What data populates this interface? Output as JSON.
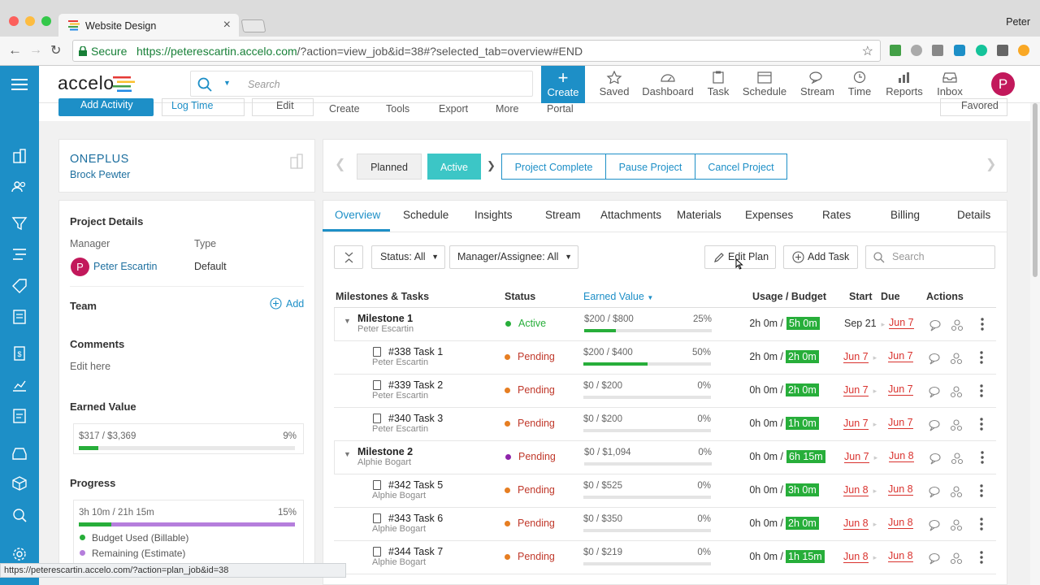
{
  "browser": {
    "tab_title": "Website Design",
    "user": "Peter",
    "secure_label": "Secure",
    "url_host": "https://peterescartin.accelo.com",
    "url_rest": "/?action=view_job&id=38#?selected_tab=overview#END",
    "status_url": "https://peterescartin.accelo.com/?action=plan_job&id=38"
  },
  "header": {
    "logo": "accelo",
    "search_placeholder": "Search",
    "create_label": "Create",
    "nav": [
      "Saved",
      "Dashboard",
      "Task",
      "Schedule",
      "Stream",
      "Time",
      "Reports",
      "Inbox"
    ],
    "avatar_initial": "P"
  },
  "toolbar": {
    "add_activity": "Add Activity",
    "log_time": "Log Time",
    "edit": "Edit",
    "create": "Create",
    "tools": "Tools",
    "export": "Export",
    "more": "More",
    "portal": "Portal",
    "favored": "Favored"
  },
  "project": {
    "company": "ONEPLUS",
    "contact": "Brock Pewter"
  },
  "details": {
    "heading": "Project Details",
    "manager_label": "Manager",
    "type_label": "Type",
    "manager_initial": "P",
    "manager_name": "Peter Escartin",
    "type_value": "Default",
    "team_heading": "Team",
    "team_add": "Add",
    "comments_heading": "Comments",
    "comments_value": "Edit here",
    "earned_heading": "Earned Value",
    "earned_amount": "$317 / $3,369",
    "earned_pct": "9%",
    "earned_fraction": 0.09,
    "progress_heading": "Progress",
    "progress_amount": "3h 10m / 21h 15m",
    "progress_pct": "15%",
    "progress_fraction": 0.15,
    "legend_billable": "Budget Used (Billable)",
    "legend_remaining": "Remaining (Estimate)",
    "color_billable": "#27ae3a",
    "color_remaining": "#b57edc"
  },
  "status": {
    "planned": "Planned",
    "active": "Active",
    "complete": "Project Complete",
    "pause": "Pause Project",
    "cancel": "Cancel Project"
  },
  "tabs": [
    "Overview",
    "Schedule",
    "Insights",
    "Stream",
    "Attachments",
    "Materials",
    "Expenses",
    "Rates",
    "Billing",
    "Details"
  ],
  "filters": {
    "status": "Status: All",
    "manager": "Manager/Assignee: All",
    "edit_plan": "Edit Plan",
    "add_task": "Add Task",
    "search_placeholder": "Search"
  },
  "table": {
    "headers": {
      "name": "Milestones & Tasks",
      "status": "Status",
      "earned": "Earned Value",
      "usage": "Usage / Budget",
      "start": "Start",
      "due": "Due",
      "actions": "Actions"
    },
    "rows": [
      {
        "kind": "milestone",
        "name": "Milestone 1",
        "assignee": "Peter Escartin",
        "status": "Active",
        "status_color": "#27ae3a",
        "earned": "$200 / $800",
        "earned_pct": "25%",
        "earned_fraction": 0.25,
        "used": "2h 0m /",
        "budget": "5h 0m",
        "start": "Sep 21",
        "start_red": false,
        "due": "Jun 7"
      },
      {
        "kind": "task",
        "name": "#338 Task 1",
        "assignee": "Peter Escartin",
        "status": "Pending",
        "status_color": "#e67e22",
        "earned": "$200 / $400",
        "earned_pct": "50%",
        "earned_fraction": 0.5,
        "used": "2h 0m /",
        "budget": "2h 0m",
        "start": "Jun 7",
        "start_red": true,
        "due": "Jun 7"
      },
      {
        "kind": "task",
        "name": "#339 Task 2",
        "assignee": "Peter Escartin",
        "status": "Pending",
        "status_color": "#e67e22",
        "earned": "$0 / $200",
        "earned_pct": "0%",
        "earned_fraction": 0,
        "used": "0h 0m /",
        "budget": "2h 0m",
        "start": "Jun 7",
        "start_red": true,
        "due": "Jun 7"
      },
      {
        "kind": "task",
        "name": "#340 Task 3",
        "assignee": "Peter Escartin",
        "status": "Pending",
        "status_color": "#e67e22",
        "earned": "$0 / $200",
        "earned_pct": "0%",
        "earned_fraction": 0,
        "used": "0h 0m /",
        "budget": "1h 0m",
        "start": "Jun 7",
        "start_red": true,
        "due": "Jun 7"
      },
      {
        "kind": "milestone",
        "name": "Milestone 2",
        "assignee": "Alphie Bogart",
        "status": "Pending",
        "status_color": "#8e24aa",
        "earned": "$0 / $1,094",
        "earned_pct": "0%",
        "earned_fraction": 0,
        "used": "0h 0m /",
        "budget": "6h 15m",
        "start": "Jun 7",
        "start_red": true,
        "due": "Jun 8"
      },
      {
        "kind": "task",
        "name": "#342 Task 5",
        "assignee": "Alphie Bogart",
        "status": "Pending",
        "status_color": "#e67e22",
        "earned": "$0 / $525",
        "earned_pct": "0%",
        "earned_fraction": 0,
        "used": "0h 0m /",
        "budget": "3h 0m",
        "start": "Jun 8",
        "start_red": true,
        "due": "Jun 8"
      },
      {
        "kind": "task",
        "name": "#343 Task 6",
        "assignee": "Alphie Bogart",
        "status": "Pending",
        "status_color": "#e67e22",
        "earned": "$0 / $350",
        "earned_pct": "0%",
        "earned_fraction": 0,
        "used": "0h 0m /",
        "budget": "2h 0m",
        "start": "Jun 8",
        "start_red": true,
        "due": "Jun 8"
      },
      {
        "kind": "task",
        "name": "#344 Task 7",
        "assignee": "Alphie Bogart",
        "status": "Pending",
        "status_color": "#e67e22",
        "earned": "$0 / $219",
        "earned_pct": "0%",
        "earned_fraction": 0,
        "used": "0h 0m /",
        "budget": "1h 15m",
        "start": "Jun 8",
        "start_red": true,
        "due": "Jun 8"
      }
    ]
  }
}
